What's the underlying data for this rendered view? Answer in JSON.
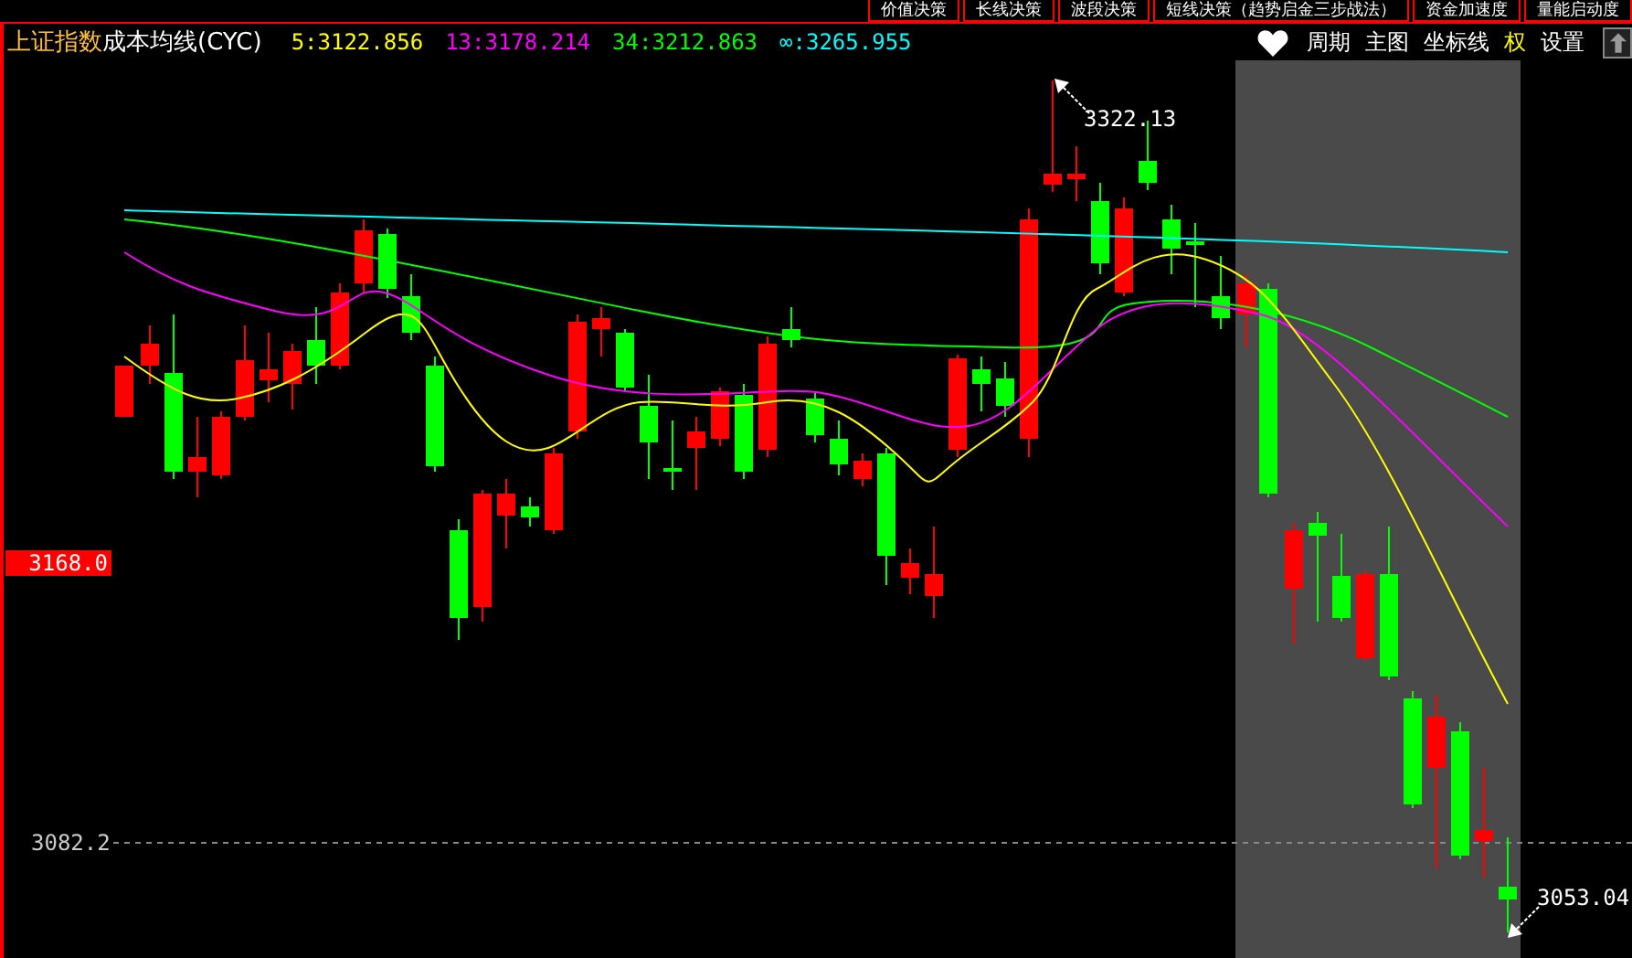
{
  "top_tabs": [
    {
      "label": "价值决策"
    },
    {
      "label": "长线决策"
    },
    {
      "label": "波段决策"
    },
    {
      "label": "短线决策（趋势启金三步战法）"
    },
    {
      "label": "资金加速度"
    },
    {
      "label": "量能启动度"
    }
  ],
  "header": {
    "index_name": "上证指数",
    "indicator": "成本均线(CYC)",
    "averages": [
      {
        "label": "5:3122.856",
        "color": "#ffff00"
      },
      {
        "label": "13:3178.214",
        "color": "#ff00ff"
      },
      {
        "label": "34:3212.863",
        "color": "#00ff00"
      },
      {
        "label": "∞:3265.955",
        "color": "#00ffff"
      }
    ]
  },
  "toolbar": [
    {
      "label": "周期",
      "selected": false
    },
    {
      "label": "主图",
      "selected": false
    },
    {
      "label": "坐标线",
      "selected": false
    },
    {
      "label": "权",
      "selected": true
    },
    {
      "label": "设置",
      "selected": false
    }
  ],
  "chart": {
    "price_marker": "3168.0",
    "grid_label": "3082.2",
    "high_label": "3322.13",
    "low_label": "3053.04"
  }
}
